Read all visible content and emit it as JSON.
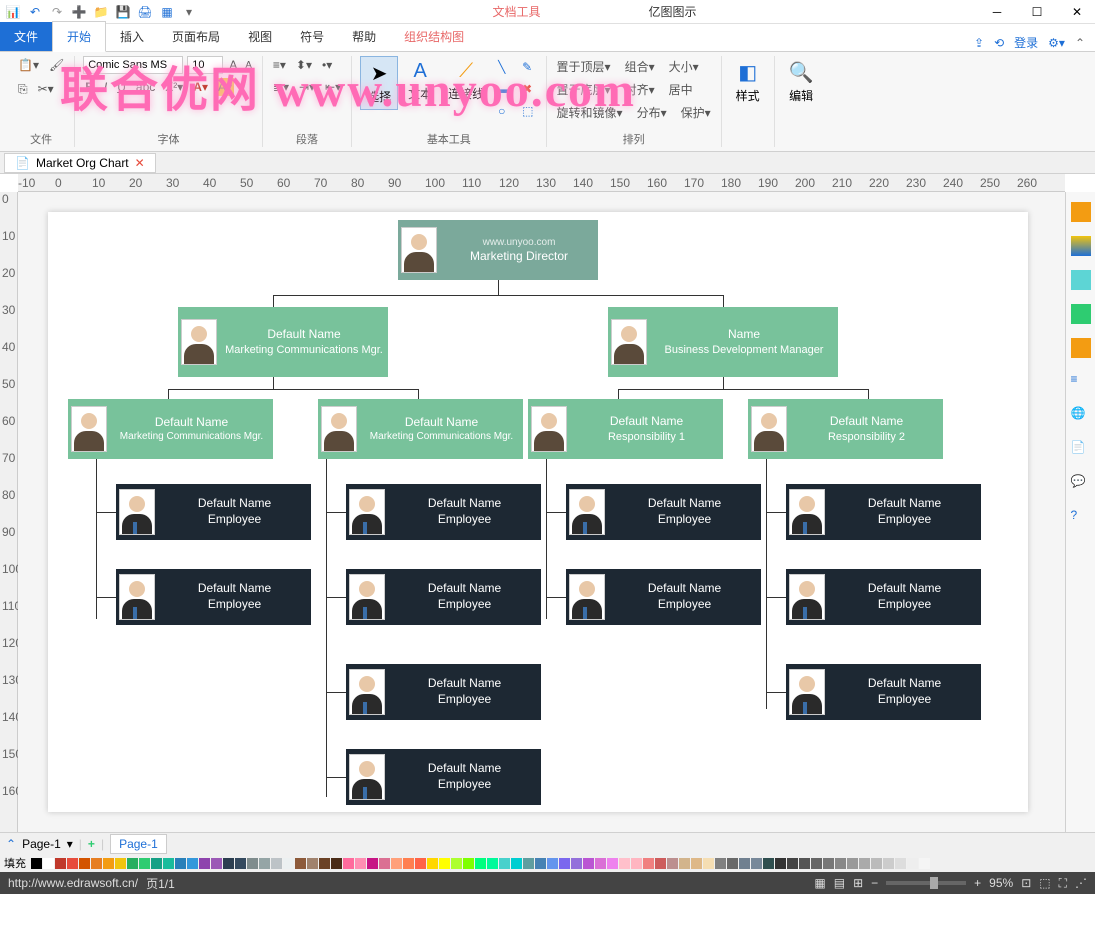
{
  "titlebar": {
    "context_tab": "文档工具",
    "app_title": "亿图图示"
  },
  "tabs": {
    "file": "文件",
    "start": "开始",
    "insert": "插入",
    "layout": "页面布局",
    "view": "视图",
    "symbol": "符号",
    "help": "帮助",
    "orgchart": "组织结构图",
    "login": "登录"
  },
  "ribbon": {
    "font_name": "Comic Sans MS",
    "font_size": "10",
    "group_file": "文件",
    "group_font": "字体",
    "group_para": "段落",
    "group_basic": "基本工具",
    "group_arrange": "排列",
    "group_style": "样式",
    "group_edit": "编辑",
    "select": "选择",
    "text": "文本",
    "connector": "连接线",
    "bring_front": "置于顶层",
    "send_back": "置于底层",
    "rotate": "旋转和镜像",
    "group": "组合",
    "align": "对齐",
    "distribute": "分布",
    "size": "大小",
    "center": "居中",
    "protect": "保护"
  },
  "doc_tab": "Market Org Chart",
  "watermark": "联合优网 www.unyoo.com",
  "org": {
    "director_sub": "www.unyoo.com",
    "director_title": "Marketing Director",
    "mgr1_name": "Default Name",
    "mgr1_title": "Marketing Communications Mgr.",
    "mgr2_name": "Name",
    "mgr2_title": "Business Development Manager",
    "sub1_name": "Default Name",
    "sub1_title": "Marketing Communications Mgr.",
    "sub2_name": "Default Name",
    "sub2_title": "Marketing Communications Mgr.",
    "sub3_name": "Default Name",
    "sub3_title": "Responsibility 1",
    "sub4_name": "Default Name",
    "sub4_title": "Responsibility 2",
    "emp_name": "Default Name",
    "emp_title": "Employee"
  },
  "ruler_h": [
    "-10",
    "0",
    "10",
    "20",
    "30",
    "40",
    "50",
    "60",
    "70",
    "80",
    "90",
    "100",
    "110",
    "120",
    "130",
    "140",
    "150",
    "160",
    "170",
    "180",
    "190",
    "200",
    "210",
    "220",
    "230",
    "240",
    "250",
    "260"
  ],
  "ruler_v": [
    "0",
    "10",
    "20",
    "30",
    "40",
    "50",
    "60",
    "70",
    "80",
    "90",
    "100",
    "110",
    "120",
    "130",
    "140",
    "150",
    "160"
  ],
  "page_nav": {
    "label": "Page-1",
    "tab": "Page-1"
  },
  "color_bar_label": "填充",
  "colors": [
    "#000",
    "#fff",
    "#c0392b",
    "#e74c3c",
    "#d35400",
    "#e67e22",
    "#f39c12",
    "#f1c40f",
    "#27ae60",
    "#2ecc71",
    "#16a085",
    "#1abc9c",
    "#2980b9",
    "#3498db",
    "#8e44ad",
    "#9b59b6",
    "#2c3e50",
    "#34495e",
    "#7f8c8d",
    "#95a5a6",
    "#bdc3c7",
    "#ecf0f1",
    "#8d5a3a",
    "#a0826d",
    "#6b4226",
    "#4a2c17",
    "#ff6b9d",
    "#ff8fb3",
    "#c71585",
    "#db7093",
    "#ffa07a",
    "#ff7f50",
    "#ff6347",
    "#ffd700",
    "#ffff00",
    "#adff2f",
    "#7fff00",
    "#00ff7f",
    "#00fa9a",
    "#48d1cc",
    "#00ced1",
    "#5f9ea0",
    "#4682b4",
    "#6495ed",
    "#7b68ee",
    "#9370db",
    "#ba55d3",
    "#da70d6",
    "#ee82ee",
    "#ffc0cb",
    "#ffb6c1",
    "#f08080",
    "#cd5c5c",
    "#bc8f8f",
    "#d2b48c",
    "#deb887",
    "#f5deb3",
    "#808080",
    "#696969",
    "#708090",
    "#778899",
    "#2f4f4f",
    "#333",
    "#444",
    "#555",
    "#666",
    "#777",
    "#888",
    "#999",
    "#aaa",
    "#bbb",
    "#ccc",
    "#ddd",
    "#eee",
    "#f5f5f5"
  ],
  "statusbar": {
    "url": "http://www.edrawsoft.cn/",
    "page": "页1/1",
    "zoom": "95%"
  }
}
